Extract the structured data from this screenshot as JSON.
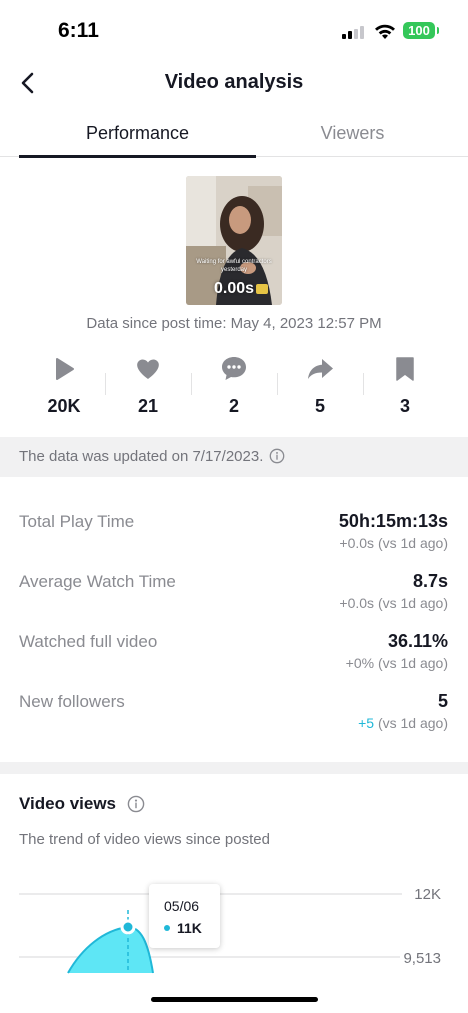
{
  "status_bar": {
    "time": "6:11",
    "battery": "100",
    "battery_color": "#34c759"
  },
  "header": {
    "title": "Video analysis",
    "back_icon": "chevron-left-icon"
  },
  "tabs": [
    {
      "label": "Performance",
      "active": true
    },
    {
      "label": "Viewers",
      "active": false
    }
  ],
  "video": {
    "caption": "Waiting for awful contractors yesterday",
    "duration": "0.00s"
  },
  "data_since": "Data since post time: May 4, 2023 12:57 PM",
  "stats": [
    {
      "icon": "play-icon",
      "value": "20K"
    },
    {
      "icon": "heart-icon",
      "value": "21"
    },
    {
      "icon": "comment-icon",
      "value": "2"
    },
    {
      "icon": "share-icon",
      "value": "5"
    },
    {
      "icon": "bookmark-icon",
      "value": "3"
    }
  ],
  "update_banner": {
    "text": "The data was updated on 7/17/2023."
  },
  "metrics": [
    {
      "label": "Total Play Time",
      "value": "50h:15m:13s",
      "change": "+0.0s",
      "change_suffix": " (vs 1d ago)"
    },
    {
      "label": "Average Watch Time",
      "value": "8.7s",
      "change": "+0.0s",
      "change_suffix": " (vs 1d ago)"
    },
    {
      "label": "Watched full video",
      "value": "36.11%",
      "change": "+0%",
      "change_suffix": " (vs 1d ago)"
    },
    {
      "label": "New followers",
      "value": "5",
      "change": "+5",
      "change_suffix": " (vs 1d ago)"
    }
  ],
  "video_views": {
    "title": "Video views",
    "subtitle": "The trend of video views since posted"
  },
  "chart_data": {
    "type": "area",
    "title": "",
    "y_tick_labels": [
      "12K",
      "9,513"
    ],
    "tooltip": {
      "date": "05/06",
      "value": "11K"
    },
    "series_color": "#5ee6f5",
    "accent": "#20b8d8"
  }
}
